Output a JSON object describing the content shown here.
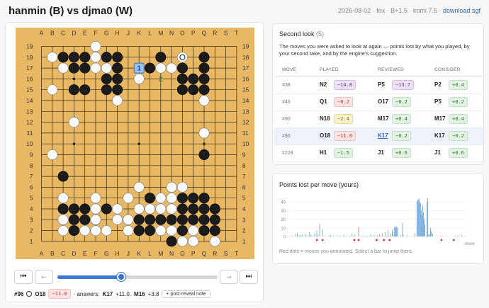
{
  "header": {
    "title": "hanmin (B) vs djma0 (W)",
    "meta": "2026-08-02 · fox · B+1.5 · komi 7.5 ·",
    "download": "download sgf"
  },
  "board": {
    "columns": [
      "A",
      "B",
      "C",
      "D",
      "E",
      "F",
      "G",
      "H",
      "J",
      "K",
      "L",
      "M",
      "N",
      "O",
      "P",
      "Q",
      "R",
      "S",
      "T"
    ],
    "rows": [
      "19",
      "18",
      "17",
      "16",
      "15",
      "14",
      "13",
      "12",
      "11",
      "10",
      "9",
      "8",
      "7",
      "6",
      "5",
      "4",
      "3",
      "2",
      "1"
    ],
    "black": [
      "C18",
      "D18",
      "E18",
      "G18",
      "H18",
      "D17",
      "E17",
      "H17",
      "G16",
      "H16",
      "D15",
      "E15",
      "G15",
      "H15",
      "M18",
      "Q18",
      "L17",
      "O17",
      "Q17",
      "O16",
      "P16",
      "Q16",
      "O15",
      "P15",
      "Q15",
      "C7",
      "Q9",
      "Q5",
      "D4",
      "E4",
      "G4",
      "P4",
      "Q4",
      "C4",
      "D3",
      "E3",
      "F3",
      "O3",
      "P3",
      "Q3",
      "R4",
      "R3",
      "K3",
      "L3",
      "M3",
      "N3",
      "K2",
      "L2",
      "O2",
      "Q2",
      "R2",
      "N1",
      "D2",
      "L5",
      "O5",
      "O4",
      "P5"
    ],
    "white": [
      "B18",
      "F19",
      "F18",
      "C17",
      "F17",
      "G17",
      "M17",
      "N17",
      "K16",
      "B15",
      "H14",
      "Q14",
      "D12",
      "Q11",
      "B9",
      "F4",
      "F5",
      "F3",
      "H3",
      "H4",
      "J3",
      "J2",
      "C5",
      "C3",
      "C2",
      "E2",
      "F2",
      "G2",
      "J5",
      "K6",
      "K4",
      "M4",
      "L4",
      "N4",
      "N6",
      "N5",
      "O1",
      "P1",
      "P2",
      "O6",
      "M2",
      "R1",
      "M5",
      "N2"
    ],
    "last_move_marker": "O18",
    "square_marker": "K17",
    "marker_label": "1",
    "move_number_labels": [
      {
        "point": "M16",
        "text": "2"
      }
    ]
  },
  "controls": {
    "first_icon": "⏮",
    "prev_icon": "←",
    "next_icon": "→",
    "last_icon": "⏭",
    "slider_fraction": 0.4
  },
  "status": {
    "move": "#96",
    "coord": "O18",
    "loss": "−11.0",
    "answers_prefix": "· answers:",
    "answer1": "K17",
    "answer1_val": "+11.0,",
    "answer2": "M16",
    "answer2_val": "+3.8",
    "note_button": "+ post-reveal note"
  },
  "second_look": {
    "title": "Second look",
    "count": "(5)",
    "description": "The moves you were asked to look at again — points lost by what you played, by your second take, and by the engine's suggestion.",
    "headers": [
      "MOVE",
      "PLAYED",
      "REVIEWED",
      "CONSIDER"
    ],
    "rows": [
      {
        "move": "#38",
        "played": "N2",
        "played_val": "−14.8",
        "played_cls": "pur",
        "reviewed": "P5",
        "reviewed_val": "−13.7",
        "reviewed_cls": "pur",
        "consider": "P2",
        "consider_val": "+0.4",
        "consider_cls": "pos"
      },
      {
        "move": "#46",
        "played": "Q1",
        "played_val": "−8.2",
        "played_cls": "neg",
        "reviewed": "O17",
        "reviewed_val": "−0.2",
        "reviewed_cls": "pos",
        "consider": "P5",
        "consider_val": "+0.2",
        "consider_cls": "pos"
      },
      {
        "move": "#90",
        "played": "N18",
        "played_val": "−2.4",
        "played_cls": "yel",
        "reviewed": "M17",
        "reviewed_val": "+0.4",
        "reviewed_cls": "pos",
        "consider": "M17",
        "consider_val": "+0.4",
        "consider_cls": "pos"
      },
      {
        "move": "#96",
        "played": "O18",
        "played_val": "−11.0",
        "played_cls": "neg",
        "reviewed": "K17",
        "reviewed_val": "−0.2",
        "reviewed_cls": "pos",
        "consider": "K17",
        "consider_val": "−0.2",
        "consider_cls": "pos",
        "highlight": true
      },
      {
        "move": "#228",
        "played": "H1",
        "played_val": "−1.5",
        "played_cls": "pos",
        "reviewed": "J1",
        "reviewed_val": "+0.6",
        "reviewed_cls": "pos",
        "consider": "J1",
        "consider_val": "+0.6",
        "consider_cls": "pos"
      }
    ]
  },
  "points_chart": {
    "title": "Points lost per move (yours)",
    "x_label": "move",
    "y_ticks": [
      "40",
      "30",
      "20",
      "10",
      "0"
    ],
    "ylim": [
      0,
      45
    ],
    "note": "Red dots = moves you annotated. Select a bar to jump there.",
    "bar_color": "#5b9bd5",
    "highlight_color": "#e0604d",
    "dot_color": "#d9342b",
    "values": [
      0.5,
      0,
      0,
      0.8,
      0,
      0.3,
      0,
      0,
      2.5,
      0,
      4,
      1,
      0,
      0.5,
      0,
      1.5,
      0,
      2,
      0,
      0.3,
      0,
      0,
      3,
      0,
      0,
      1,
      0,
      5,
      0,
      2,
      0,
      0,
      1,
      0,
      4,
      0,
      0,
      7,
      2,
      0,
      0,
      14.8,
      0,
      0,
      0,
      8.2,
      0,
      0,
      0.8,
      0,
      0,
      0,
      0,
      0.2,
      0,
      1.5,
      1,
      0,
      0,
      0,
      0.5,
      0,
      0,
      0.7,
      0,
      0.3,
      0,
      0.4,
      0,
      0,
      0.6,
      0,
      0,
      0.3,
      0,
      2,
      0,
      0,
      0.4,
      0,
      0,
      0,
      0.7,
      0,
      0.3,
      0,
      3.5,
      0,
      0.5,
      0,
      2.4,
      0,
      0,
      0,
      0,
      11.0,
      0,
      0,
      0,
      0,
      0.6,
      0,
      0.3,
      1,
      0,
      0.4,
      0,
      0.8,
      0,
      0,
      0.5,
      0,
      2.5,
      0,
      0,
      1,
      0,
      0.6,
      0,
      0,
      0,
      1.5,
      0,
      0.3,
      3,
      0,
      1,
      0,
      4,
      0,
      0,
      0.4,
      5,
      0,
      0.8,
      0,
      7,
      1,
      0,
      0.4,
      3,
      0,
      8,
      5,
      0,
      11,
      10,
      12,
      11,
      10,
      0,
      0,
      0,
      2,
      0,
      0,
      16,
      2,
      0,
      0,
      0,
      0,
      1.5,
      0,
      0,
      0,
      0.3,
      0,
      0,
      0,
      0,
      0,
      0,
      4,
      0,
      0,
      41,
      42,
      43,
      44,
      40,
      38,
      30,
      25,
      36,
      28,
      20,
      14,
      0,
      0,
      40,
      44,
      2,
      0,
      3,
      10,
      6,
      0,
      3,
      0,
      0,
      0,
      0,
      0,
      0.3,
      0,
      0,
      0,
      0,
      1,
      0,
      0.6,
      0,
      0.3,
      0,
      0,
      0,
      0.2,
      0,
      0,
      0,
      0,
      0,
      0,
      0,
      0,
      0,
      0,
      0,
      0.5,
      0,
      0,
      0,
      1.5,
      0,
      0,
      0,
      0,
      2,
      0,
      0,
      0.3,
      0,
      0.5
    ],
    "highlight_index": 95,
    "annotated_indices": [
      37,
      45,
      89,
      95,
      120,
      130,
      138,
      210,
      227
    ]
  }
}
